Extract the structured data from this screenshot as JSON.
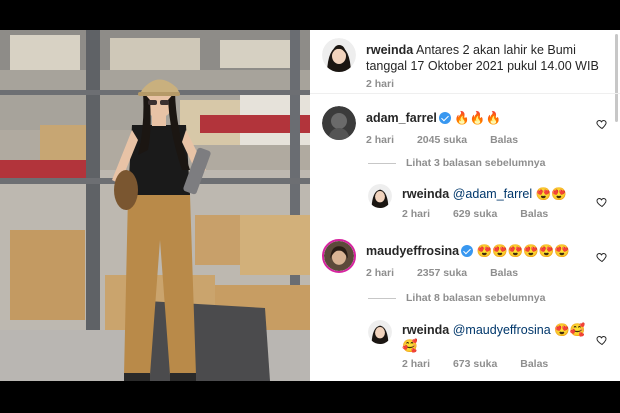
{
  "post": {
    "author": "rweinda",
    "caption": "Antares 2 akan lahir ke Bumi tanggal 17 Oktober 2021 pukul 14.00 WIB",
    "time": "2 hari"
  },
  "comments": [
    {
      "username": "adam_farrel",
      "verified": true,
      "text": "🔥🔥🔥",
      "time": "2 hari",
      "likes": "2045 suka",
      "reply_label": "Balas"
    },
    {
      "type": "view_replies",
      "label": "Lihat 3 balasan sebelumnya"
    },
    {
      "username": "rweinda",
      "mention": "@adam_farrel",
      "text": "😍😍",
      "time": "2 hari",
      "likes": "629 suka",
      "reply_label": "Balas"
    },
    {
      "username": "maudyeffrosina",
      "verified": true,
      "text": "😍😍😍😍😍😍",
      "time": "2 hari",
      "likes": "2357 suka",
      "reply_label": "Balas"
    },
    {
      "type": "view_replies",
      "label": "Lihat 8 balasan sebelumnya"
    },
    {
      "username": "rweinda",
      "mention": "@maudyeffrosina",
      "text": "😍🥰",
      "text_line2": "🥰",
      "time": "2 hari",
      "likes": "673 suka",
      "reply_label": "Balas"
    }
  ],
  "icons": {
    "like": "heart-outline-icon",
    "verified": "verified-badge-icon"
  },
  "colors": {
    "verified": "#3897f0",
    "meta": "#8e8e8e",
    "text": "#262626"
  }
}
